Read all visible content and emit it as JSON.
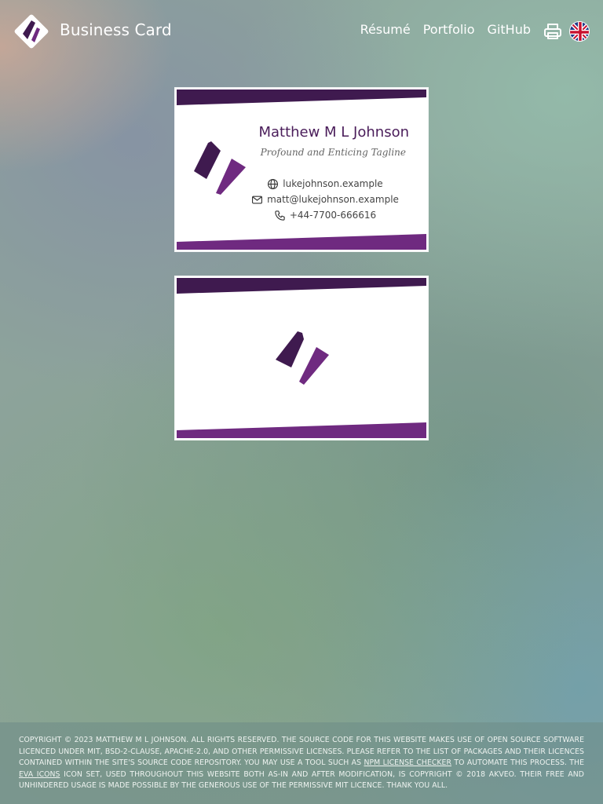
{
  "header": {
    "site_title": "Business Card",
    "nav": [
      {
        "label": "Résumé"
      },
      {
        "label": "Portfolio"
      },
      {
        "label": "GitHub"
      }
    ],
    "print_icon": "printer-icon",
    "language_icon": "uk-flag-icon"
  },
  "card_front": {
    "name": "Matthew M L Johnson",
    "tagline": "Profound and Enticing Tagline",
    "contacts": [
      {
        "icon": "globe-icon",
        "text": "lukejohnson.example"
      },
      {
        "icon": "email-icon",
        "text": "matt@lukejohnson.example"
      },
      {
        "icon": "phone-icon",
        "text": "+44-7700-666616"
      }
    ]
  },
  "card_back": {
    "logo_icon": "brand-logo-icon"
  },
  "footer": {
    "text_1": "Copyright © 2023 Matthew M L Johnson. All rights reserved. The source code for this website makes use of open source software licenced under MIT, BSD-2-Clause, Apache-2.0, and other permissive licenses. Please refer to the list of packages and their licences contained within the site's source code repository. You may use a tool such as ",
    "link_1": "npm license checker",
    "text_2": " to automate this process. The ",
    "link_2": "Eva Icons",
    "text_3": " icon set, used throughout this website both as-in and after modification, is copyright © 2018 Akveo. Their free and unhindered usage is made possible by the generous use of the permissive MIT licence. Thank you all."
  },
  "colors": {
    "brand_dark": "#3f1a4f",
    "brand_light": "#6f2a80"
  }
}
